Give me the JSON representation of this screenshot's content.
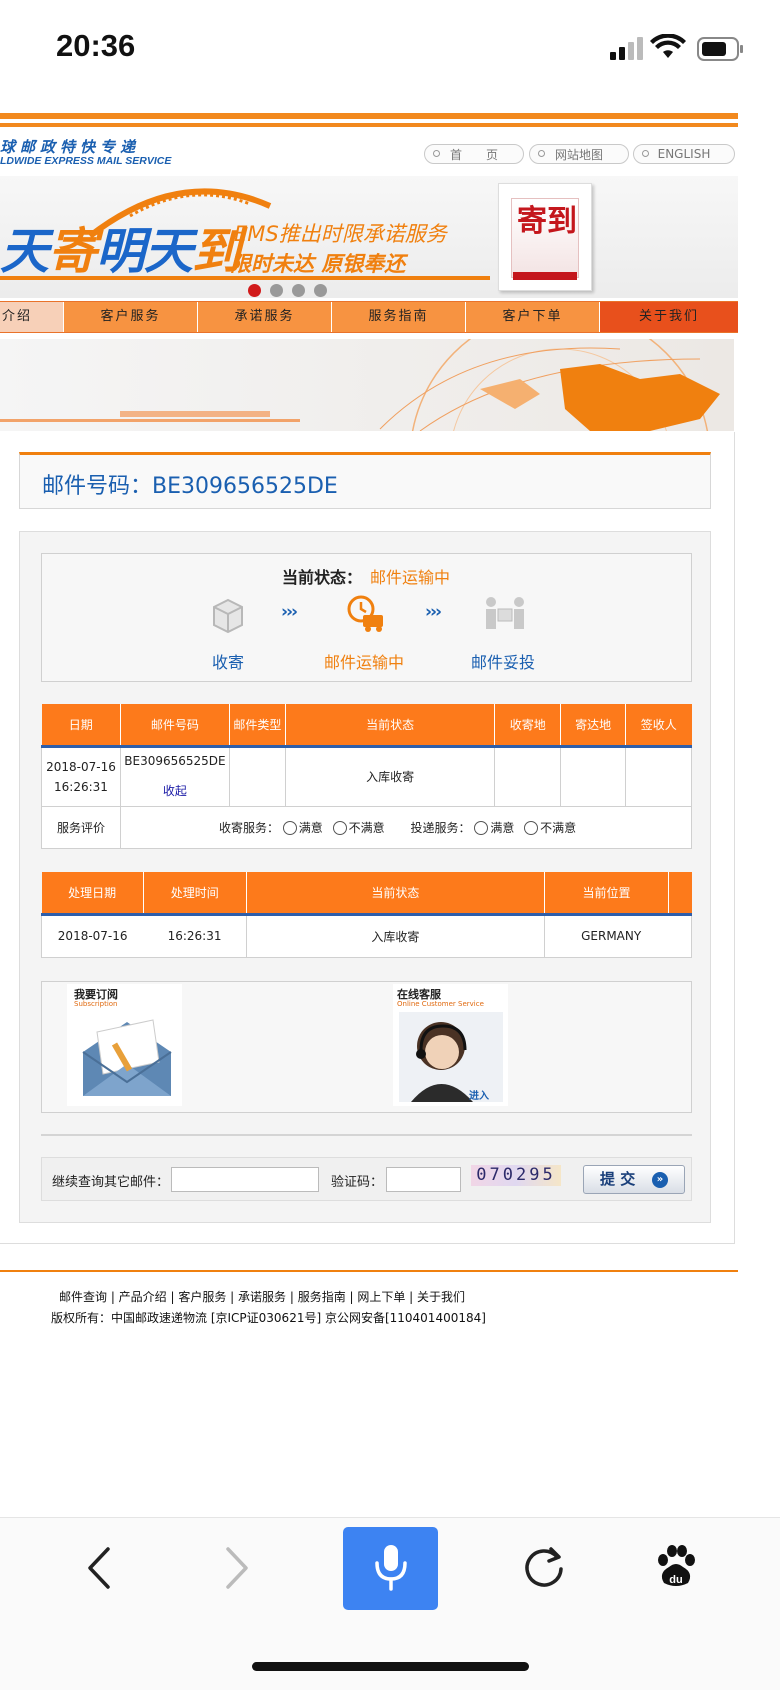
{
  "status_bar": {
    "time": "20:36"
  },
  "header": {
    "logo_cn": "球邮政特快专递",
    "logo_en": "LDWIDE EXPRESS MAIL SERVICE",
    "links": [
      "首　　页",
      "网站地图",
      "ENGLISH"
    ]
  },
  "banner": {
    "big_text_a": "天",
    "big_text_b": "寄",
    "big_text_c": "明天",
    "big_text_d": "到",
    "line1": "EMS推出时限承诺服务",
    "line2": "限时未达 原银奉还",
    "package_text": "寄到",
    "slides_total": 4,
    "slide_active": 1
  },
  "nav": {
    "items": [
      "介绍",
      "客户服务",
      "承诺服务",
      "服务指南",
      "客户下单",
      "关于我们"
    ]
  },
  "tracking": {
    "label": "邮件号码：",
    "number": "BE309656525DE"
  },
  "status": {
    "label": "当前状态：",
    "value": "邮件运输中",
    "steps": [
      "收寄",
      "邮件运输中",
      "邮件妥投"
    ],
    "arrow": "›››"
  },
  "mail_table": {
    "headers": [
      "日期",
      "邮件号码",
      "邮件类型",
      "当前状态",
      "收寄地",
      "寄达地",
      "签收人"
    ],
    "row": {
      "date": "2018-07-16 16:26:31",
      "number": "BE309656525DE",
      "collapse": "收起",
      "type": "",
      "status": "入库收寄",
      "origin": "",
      "dest": "",
      "signer": ""
    },
    "rating_label": "服务评价",
    "collect_label": "收寄服务：",
    "deliver_label": "投递服务：",
    "satisfied": "满意",
    "unsatisfied": "不满意"
  },
  "detail_table": {
    "headers": [
      "处理日期",
      "处理时间",
      "当前状态",
      "当前位置"
    ],
    "rows": [
      {
        "date": "2018-07-16",
        "time": "16:26:31",
        "status": "入库收寄",
        "location": "GERMANY"
      }
    ]
  },
  "promo": {
    "sub_title": "我要订阅",
    "sub_en": "Subscription",
    "cs_title": "在线客服",
    "cs_en": "Online Customer Service",
    "cs_enter": "进入"
  },
  "query": {
    "label": "继续查询其它邮件：",
    "captcha_label": "验证码：",
    "captcha": "070295",
    "submit": "提 交"
  },
  "footer": {
    "links": "邮件查询 | 产品介绍 | 客户服务 | 承诺服务 | 服务指南 | 网上下单 | 关于我们",
    "copyright": "版权所有：中国邮政速递物流 [京ICP证030621号] 京公网安备[110401400184]"
  },
  "toolbar": {
    "icons": [
      "back-icon",
      "forward-icon",
      "microphone-icon",
      "reload-icon",
      "baidu-paw-icon"
    ],
    "baidu_text": "du"
  },
  "colors": {
    "orange": "#f0800f",
    "blue": "#1a5fb0",
    "mic_blue": "#3d83f2"
  }
}
